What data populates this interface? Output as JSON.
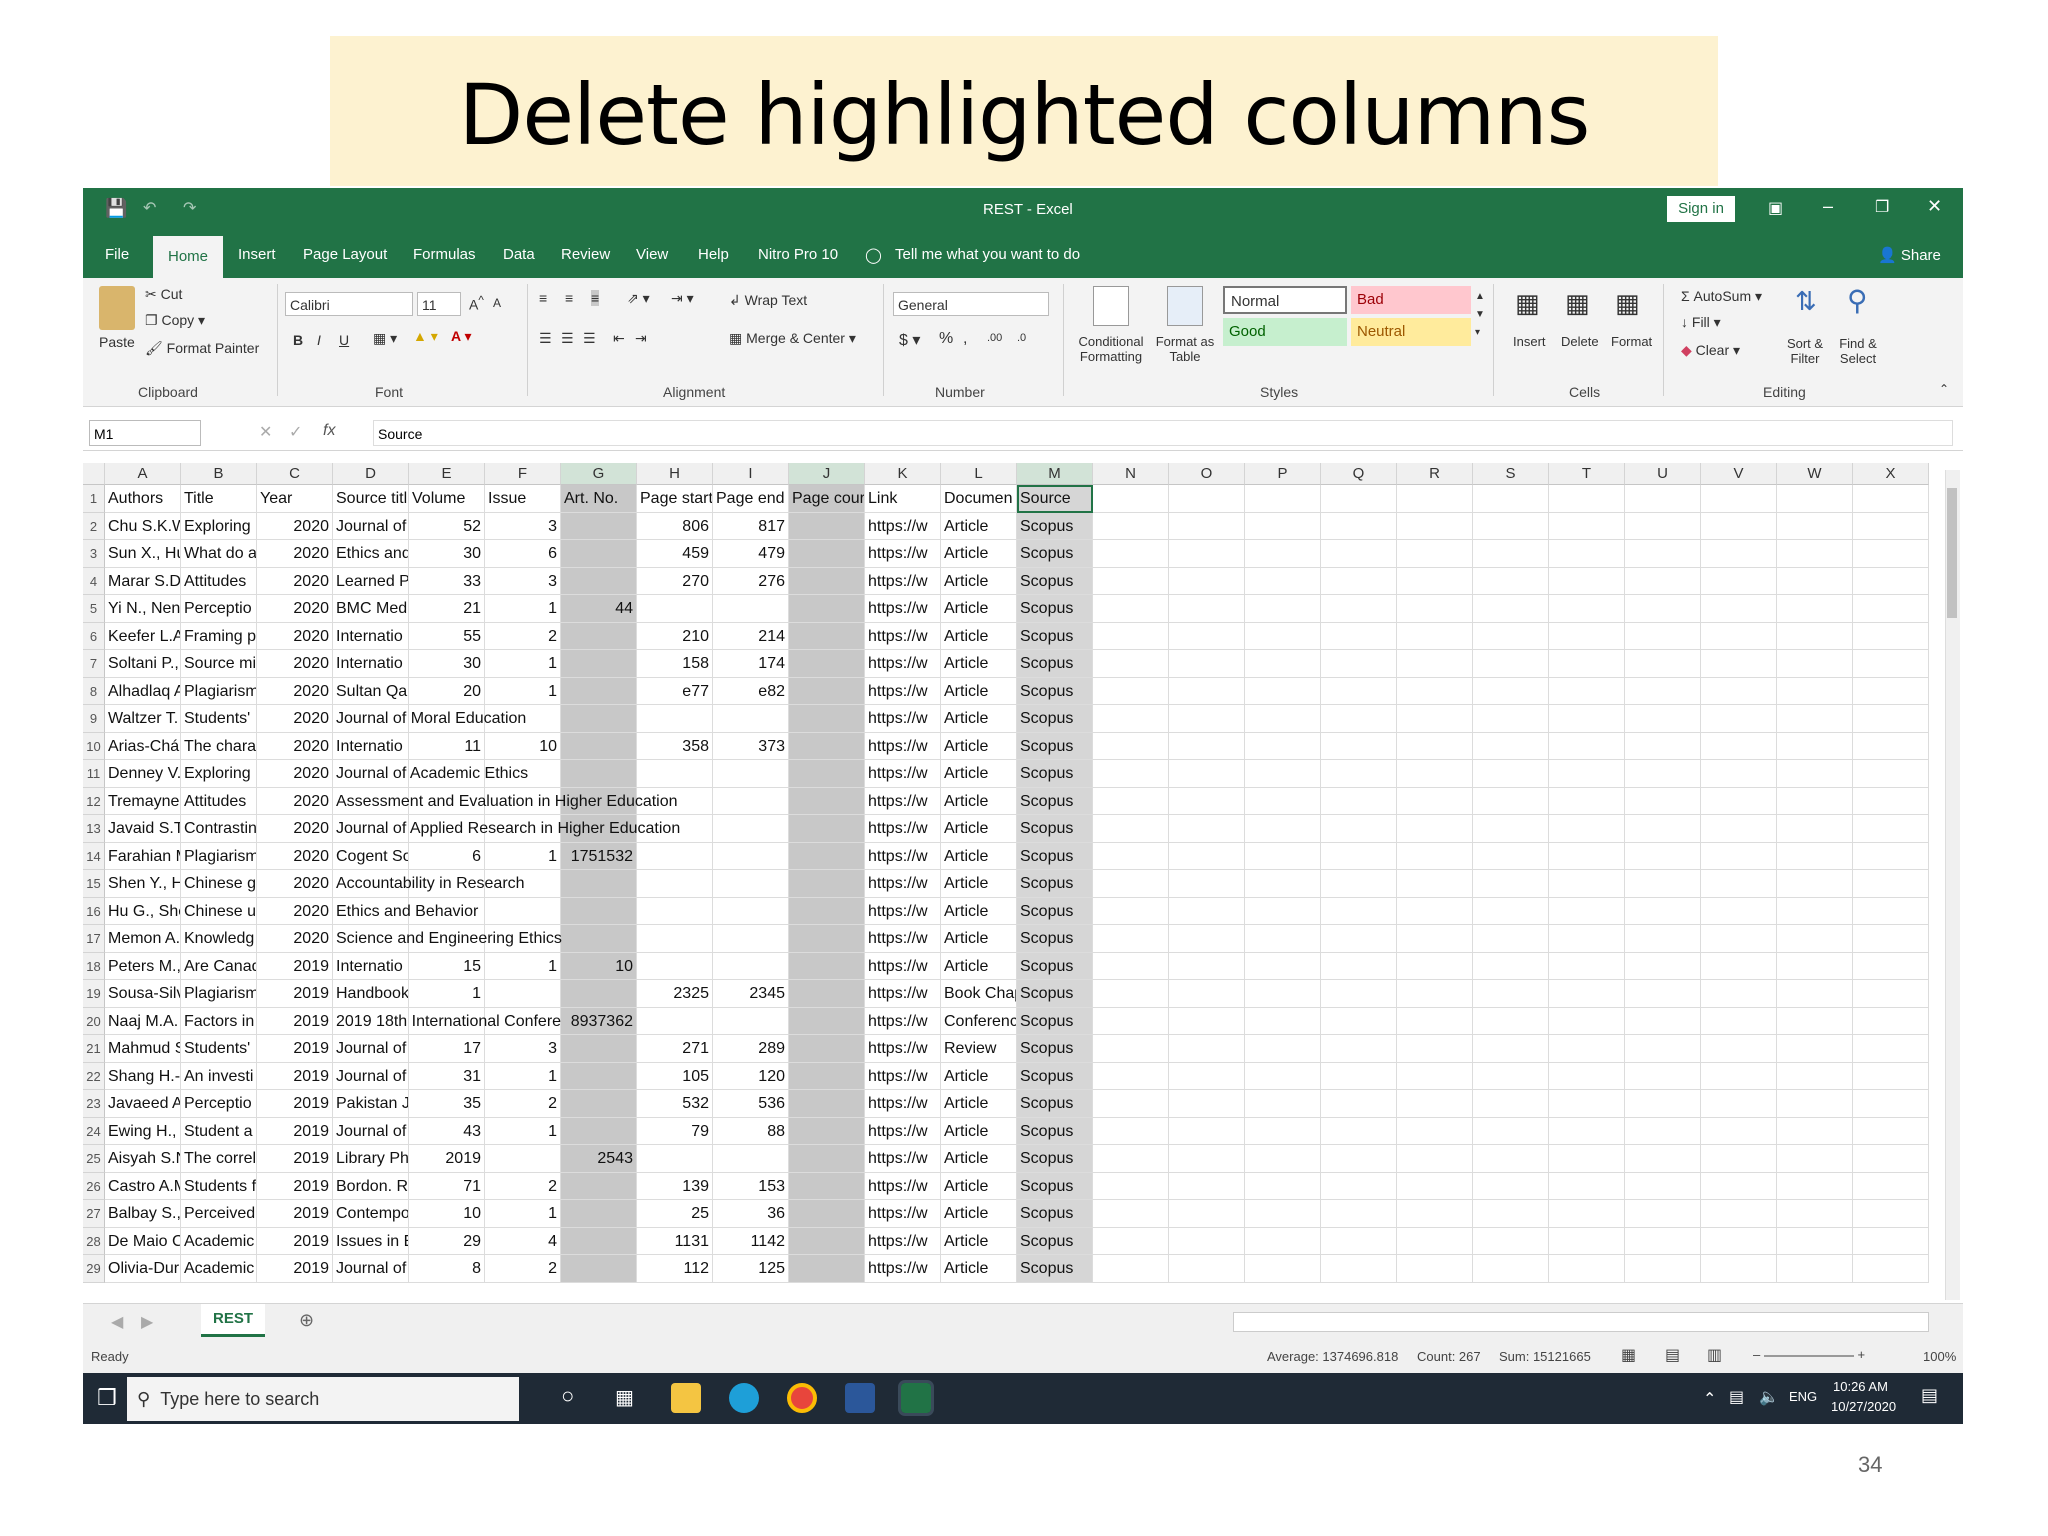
{
  "slide": {
    "title": "Delete highlighted columns",
    "page_number": "34"
  },
  "window": {
    "title": "REST - Excel",
    "sign_in": "Sign in",
    "share": "Share"
  },
  "menu": [
    "File",
    "Home",
    "Insert",
    "Page Layout",
    "Formulas",
    "Data",
    "Review",
    "View",
    "Help",
    "Nitro Pro 10"
  ],
  "tell_me": "Tell me what you want to do",
  "ribbon": {
    "clipboard": {
      "paste": "Paste",
      "cut": "Cut",
      "copy": "Copy",
      "format_painter": "Format Painter",
      "label": "Clipboard"
    },
    "font": {
      "name": "Calibri",
      "size": "11",
      "label": "Font"
    },
    "alignment": {
      "wrap": "Wrap Text",
      "merge": "Merge & Center",
      "label": "Alignment"
    },
    "number": {
      "format": "General",
      "label": "Number"
    },
    "styles": {
      "conditional": "Conditional Formatting",
      "format_table": "Format as Table",
      "normal": "Normal",
      "bad": "Bad",
      "good": "Good",
      "neutral": "Neutral",
      "label": "Styles"
    },
    "cells": {
      "insert": "Insert",
      "delete": "Delete",
      "format": "Format",
      "label": "Cells"
    },
    "editing": {
      "autosum": "AutoSum",
      "fill": "Fill",
      "clear": "Clear",
      "sort": "Sort & Filter",
      "find": "Find & Select",
      "label": "Editing"
    }
  },
  "formula_bar": {
    "name_box": "M1",
    "fx": "fx",
    "value": "Source"
  },
  "columns": [
    "A",
    "B",
    "C",
    "D",
    "E",
    "F",
    "G",
    "H",
    "I",
    "J",
    "K",
    "L",
    "M",
    "N",
    "O",
    "P",
    "Q",
    "R",
    "S",
    "T",
    "U",
    "V",
    "W",
    "X"
  ],
  "highlighted_columns": [
    "G",
    "J",
    "M"
  ],
  "headers": [
    "Authors",
    "Title",
    "Year",
    "Source titl",
    "Volume",
    "Issue",
    "Art. No.",
    "Page start",
    "Page end",
    "Page cour",
    "Link",
    "Documen",
    "Source"
  ],
  "rows": [
    [
      "Chu S.K.W",
      "Exploring",
      "2020",
      "Journal of",
      "52",
      "3",
      "",
      "806",
      "817",
      "",
      "https://w",
      "Article",
      "Scopus"
    ],
    [
      "Sun X., Hu",
      "What do a",
      "2020",
      "Ethics and",
      "30",
      "6",
      "",
      "459",
      "479",
      "",
      "https://w",
      "Article",
      "Scopus"
    ],
    [
      "Marar S.D.",
      "Attitudes",
      "2020",
      "Learned P",
      "33",
      "3",
      "",
      "270",
      "276",
      "",
      "https://w",
      "Article",
      "Scopus"
    ],
    [
      "Yi N., Nen",
      "Perceptio",
      "2020",
      "BMC Medi",
      "21",
      "1",
      "44",
      "",
      "",
      "",
      "https://w",
      "Article",
      "Scopus"
    ],
    [
      "Keefer L.A",
      "Framing p",
      "2020",
      "Internatio",
      "55",
      "2",
      "",
      "210",
      "214",
      "",
      "https://w",
      "Article",
      "Scopus"
    ],
    [
      "Soltani P.,",
      "Source mi",
      "2020",
      "Internatio",
      "30",
      "1",
      "",
      "158",
      "174",
      "",
      "https://w",
      "Article",
      "Scopus"
    ],
    [
      "Alhadlaq A",
      "Plagiarism",
      "2020",
      "Sultan Qal",
      "20",
      "1",
      "",
      "e77",
      "e82",
      "",
      "https://w",
      "Article",
      "Scopus"
    ],
    [
      "Waltzer T.",
      "Students'",
      "2020",
      "Journal of Moral Education",
      "",
      "",
      "",
      "",
      "",
      "",
      "https://w",
      "Article",
      "Scopus"
    ],
    [
      "Arias-Chá",
      "The chara",
      "2020",
      "Internatio",
      "11",
      "10",
      "",
      "358",
      "373",
      "",
      "https://w",
      "Article",
      "Scopus"
    ],
    [
      "Denney V.",
      "Exploring",
      "2020",
      "Journal of Academic Ethics",
      "",
      "",
      "",
      "",
      "",
      "",
      "https://w",
      "Article",
      "Scopus"
    ],
    [
      "Tremayne",
      "Attitudes",
      "2020",
      "Assessment and Evaluation in Higher Education",
      "",
      "",
      "",
      "",
      "",
      "",
      "https://w",
      "Article",
      "Scopus"
    ],
    [
      "Javaid S.T.",
      "Contrastin",
      "2020",
      "Journal of Applied Research in Higher Education",
      "",
      "",
      "",
      "",
      "",
      "",
      "https://w",
      "Article",
      "Scopus"
    ],
    [
      "Farahian M",
      "Plagiarism",
      "2020",
      "Cogent So",
      "6",
      "1",
      "1751532",
      "",
      "",
      "",
      "https://w",
      "Article",
      "Scopus"
    ],
    [
      "Shen Y., H",
      "Chinese g",
      "2020",
      "Accountability in Research",
      "",
      "",
      "",
      "",
      "",
      "",
      "https://w",
      "Article",
      "Scopus"
    ],
    [
      "Hu G., She",
      "Chinese u",
      "2020",
      "Ethics and Behavior",
      "",
      "",
      "",
      "",
      "",
      "",
      "https://w",
      "Article",
      "Scopus"
    ],
    [
      "Memon A.",
      "Knowledg",
      "2020",
      "Science and Engineering Ethics",
      "",
      "",
      "",
      "",
      "",
      "",
      "https://w",
      "Article",
      "Scopus"
    ],
    [
      "Peters M.,",
      "Are Canad",
      "2019",
      "Internatio",
      "15",
      "1",
      "10",
      "",
      "",
      "",
      "https://w",
      "Article",
      "Scopus"
    ],
    [
      "Sousa-Silv",
      "Plagiarism",
      "2019",
      "Handbook",
      "1",
      "",
      "",
      "2325",
      "2345",
      "",
      "https://w",
      "Book Chap",
      "Scopus"
    ],
    [
      "Naaj M.A.",
      "Factors in",
      "2019",
      "2019 18th International Confere",
      "",
      "",
      "8937362",
      "",
      "",
      "",
      "https://w",
      "Conferenc",
      "Scopus"
    ],
    [
      "Mahmud S",
      "Students'",
      "2019",
      "Journal of",
      "17",
      "3",
      "",
      "271",
      "289",
      "",
      "https://w",
      "Review",
      "Scopus"
    ],
    [
      "Shang H.-I",
      "An investi",
      "2019",
      "Journal of",
      "31",
      "1",
      "",
      "105",
      "120",
      "",
      "https://w",
      "Article",
      "Scopus"
    ],
    [
      "Javaeed A",
      "Perceptio",
      "2019",
      "Pakistan J",
      "35",
      "2",
      "",
      "532",
      "536",
      "",
      "https://w",
      "Article",
      "Scopus"
    ],
    [
      "Ewing H.,",
      "Student a",
      "2019",
      "Journal of",
      "43",
      "1",
      "",
      "79",
      "88",
      "",
      "https://w",
      "Article",
      "Scopus"
    ],
    [
      "Aisyah S.N",
      "The correl",
      "2019",
      "Library Ph",
      "2019",
      "",
      "2543",
      "",
      "",
      "",
      "https://w",
      "Article",
      "Scopus"
    ],
    [
      "Castro A.M",
      "Students f",
      "2019",
      "Bordon. R",
      "71",
      "2",
      "",
      "139",
      "153",
      "",
      "https://w",
      "Article",
      "Scopus"
    ],
    [
      "Balbay S.,",
      "Perceived",
      "2019",
      "Contempo",
      "10",
      "1",
      "",
      "25",
      "36",
      "",
      "https://w",
      "Article",
      "Scopus"
    ],
    [
      "De Maio C",
      "Academic",
      "2019",
      "Issues in E",
      "29",
      "4",
      "",
      "1131",
      "1142",
      "",
      "https://w",
      "Article",
      "Scopus"
    ],
    [
      "Olivia-Dur",
      "Academic",
      "2019",
      "Journal of",
      "8",
      "2",
      "",
      "112",
      "125",
      "",
      "https://w",
      "Article",
      "Scopus"
    ]
  ],
  "sheet_tab": "REST",
  "status": {
    "ready": "Ready",
    "average": "Average: 1374696.818",
    "count": "Count: 267",
    "sum": "Sum: 15121665",
    "zoom": "100%"
  },
  "taskbar": {
    "search_placeholder": "Type here to search",
    "time": "10:26 AM",
    "date": "10/27/2020",
    "lang": "ENG"
  }
}
